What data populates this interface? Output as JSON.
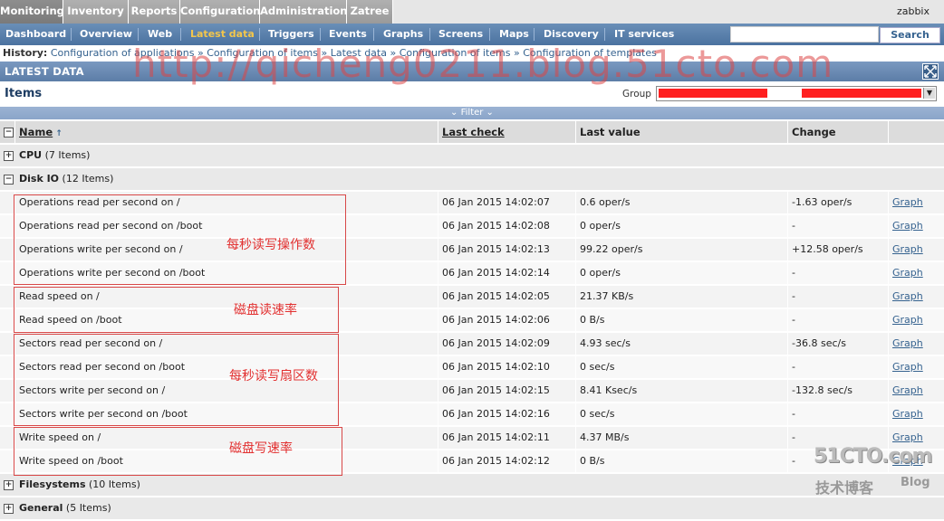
{
  "top_menu": {
    "items": [
      "Monitoring",
      "Inventory",
      "Reports",
      "Configuration",
      "Administration",
      "Zatree"
    ],
    "user": "zabbix"
  },
  "sub_menu": {
    "items": [
      "Dashboard",
      "Overview",
      "Web",
      "Latest data",
      "Triggers",
      "Events",
      "Graphs",
      "Screens",
      "Maps",
      "Discovery",
      "IT services"
    ],
    "selected": "Latest data",
    "search_button": "Search",
    "search_value": ""
  },
  "history": {
    "label": "History:",
    "items": [
      "Configuration of applications",
      "Configuration of items",
      "Latest data",
      "Configuration of items",
      "Configuration of templates"
    ]
  },
  "latest_data": {
    "title": "LATEST DATA"
  },
  "items_header": {
    "title": "Items",
    "group_label": "Group"
  },
  "filter": {
    "label": "Filter"
  },
  "table": {
    "columns": [
      "Name",
      "Last check",
      "Last value",
      "Change"
    ],
    "groups": [
      {
        "name": "CPU",
        "count": "(7 Items)",
        "expanded": false
      },
      {
        "name": "Disk IO",
        "count": "(12 Items)",
        "expanded": true
      },
      {
        "name": "Filesystems",
        "count": "(10 Items)",
        "expanded": false
      },
      {
        "name": "General",
        "count": "(5 Items)",
        "expanded": false
      }
    ],
    "rows": [
      {
        "name": "Operations read per second on /",
        "last_check": "06 Jan 2015 14:02:07",
        "last_value": "0.6 oper/s",
        "change": "-1.63 oper/s",
        "graph": "Graph"
      },
      {
        "name": "Operations read per second on /boot",
        "last_check": "06 Jan 2015 14:02:08",
        "last_value": "0 oper/s",
        "change": "-",
        "graph": "Graph"
      },
      {
        "name": "Operations write per second on /",
        "last_check": "06 Jan 2015 14:02:13",
        "last_value": "99.22 oper/s",
        "change": "+12.58 oper/s",
        "graph": "Graph"
      },
      {
        "name": "Operations write per second on /boot",
        "last_check": "06 Jan 2015 14:02:14",
        "last_value": "0 oper/s",
        "change": "-",
        "graph": "Graph"
      },
      {
        "name": "Read speed on /",
        "last_check": "06 Jan 2015 14:02:05",
        "last_value": "21.37 KB/s",
        "change": "-",
        "graph": "Graph"
      },
      {
        "name": "Read speed on /boot",
        "last_check": "06 Jan 2015 14:02:06",
        "last_value": "0 B/s",
        "change": "-",
        "graph": "Graph"
      },
      {
        "name": "Sectors read per second on /",
        "last_check": "06 Jan 2015 14:02:09",
        "last_value": "4.93 sec/s",
        "change": "-36.8 sec/s",
        "graph": "Graph"
      },
      {
        "name": "Sectors read per second on /boot",
        "last_check": "06 Jan 2015 14:02:10",
        "last_value": "0 sec/s",
        "change": "-",
        "graph": "Graph"
      },
      {
        "name": "Sectors write per second on /",
        "last_check": "06 Jan 2015 14:02:15",
        "last_value": "8.41 Ksec/s",
        "change": "-132.8 sec/s",
        "graph": "Graph"
      },
      {
        "name": "Sectors write per second on /boot",
        "last_check": "06 Jan 2015 14:02:16",
        "last_value": "0 sec/s",
        "change": "-",
        "graph": "Graph"
      },
      {
        "name": "Write speed on /",
        "last_check": "06 Jan 2015 14:02:11",
        "last_value": "4.37 MB/s",
        "change": "-",
        "graph": "Graph"
      },
      {
        "name": "Write speed on /boot",
        "last_check": "06 Jan 2015 14:02:12",
        "last_value": "0 B/s",
        "change": "-",
        "graph": "Graph"
      }
    ]
  },
  "annotations": [
    "每秒读写操作数",
    "磁盘读速率",
    "每秒读写扇区数",
    "磁盘写速率"
  ],
  "watermark": "http://qicheng0211.blog.51cto.com",
  "logo": {
    "brand": "51CTO.com",
    "sub": "技术博客",
    "blog": "Blog"
  },
  "colors": {
    "submenu_bg": "#4b72a0",
    "selected_submenu": "#f3c64b",
    "annotation": "#e23030",
    "link": "#35628f"
  }
}
